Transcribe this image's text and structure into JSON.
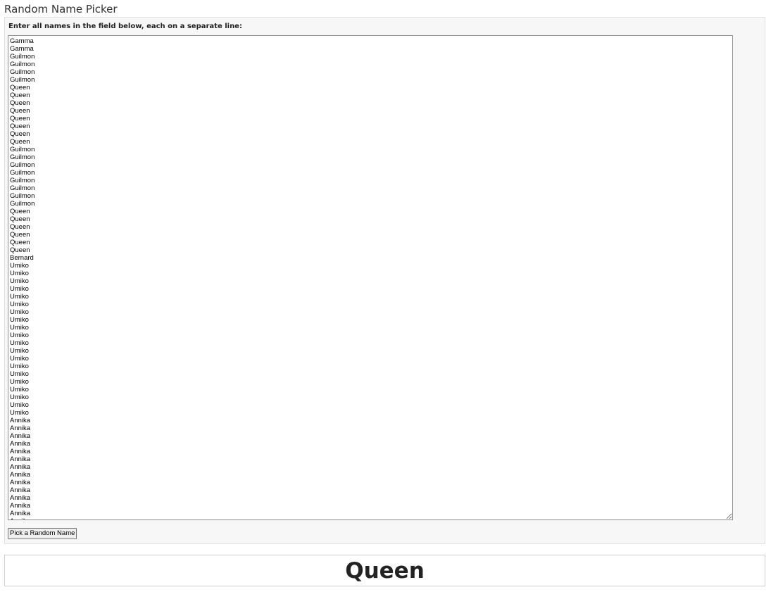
{
  "app": {
    "title": "Random Name Picker"
  },
  "form": {
    "instructions": "Enter all names in the field below, each on a separate line:",
    "names": [
      "Gamma",
      "Gamma",
      "Guilmon",
      "Guilmon",
      "Guilmon",
      "Guilmon",
      "Queen",
      "Queen",
      "Queen",
      "Queen",
      "Queen",
      "Queen",
      "Queen",
      "Queen",
      "Guilmon",
      "Guilmon",
      "Guilmon",
      "Guilmon",
      "Guilmon",
      "Guilmon",
      "Guilmon",
      "Guilmon",
      "Queen",
      "Queen",
      "Queen",
      "Queen",
      "Queen",
      "Queen",
      "Bernard",
      "Umiko",
      "Umiko",
      "Umiko",
      "Umiko",
      "Umiko",
      "Umiko",
      "Umiko",
      "Umiko",
      "Umiko",
      "Umiko",
      "Umiko",
      "Umiko",
      "Umiko",
      "Umiko",
      "Umiko",
      "Umiko",
      "Umiko",
      "Umiko",
      "Umiko",
      "Umiko",
      "Annika",
      "Annika",
      "Annika",
      "Annika",
      "Annika",
      "Annika",
      "Annika",
      "Annika",
      "Annika",
      "Annika",
      "Annika",
      "Annika",
      "Annika",
      "Annika"
    ],
    "pick_button_label": "Pick a Random Name"
  },
  "result": {
    "picked_name": "Queen"
  }
}
